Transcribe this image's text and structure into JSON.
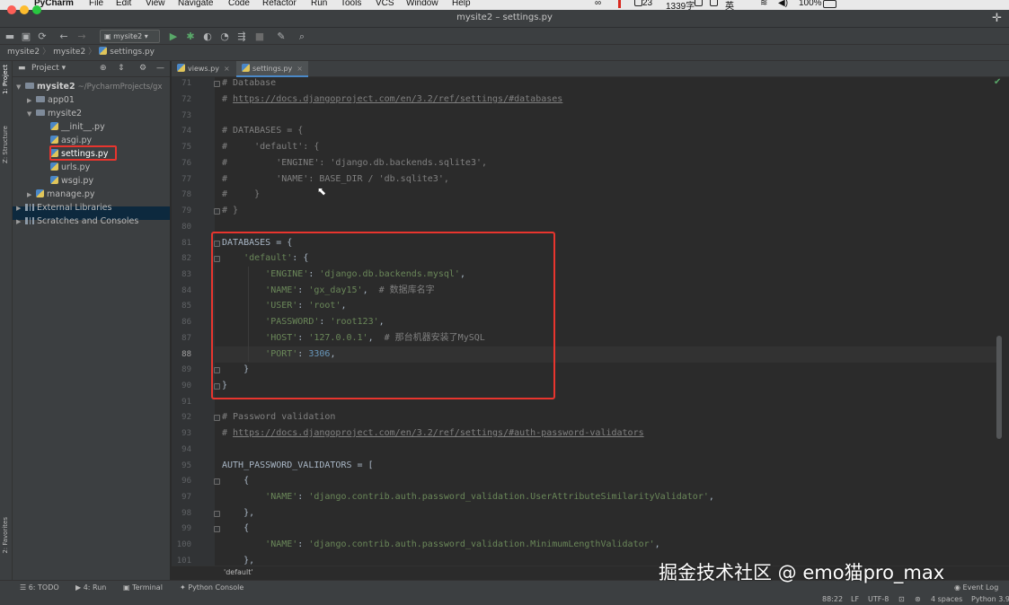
{
  "menubar": {
    "app_name": "PyCharm",
    "items": [
      "File",
      "Edit",
      "View",
      "Navigate",
      "Code",
      "Refactor",
      "Run",
      "Tools",
      "VCS",
      "Window",
      "Help"
    ],
    "status": {
      "badge": "23",
      "counter": "1339字",
      "battery": "100%",
      "lang": "英"
    }
  },
  "window": {
    "title": "mysite2 – settings.py"
  },
  "toolbar": {
    "run_config": "mysite2"
  },
  "breadcrumb": {
    "project": "mysite2",
    "folder": "mysite2",
    "file": "settings.py"
  },
  "left_stripe": {
    "project_tab": "1: Project",
    "structure_tab": "Z: Structure",
    "favorites_tab": "2: Favorites"
  },
  "project_panel": {
    "title": "Project",
    "tree": [
      {
        "label": "mysite2",
        "suffix": "~/PycharmProjects/gx",
        "type": "root-folder"
      },
      {
        "label": "app01",
        "type": "folder"
      },
      {
        "label": "mysite2",
        "type": "folder"
      },
      {
        "label": "__init__.py",
        "type": "py"
      },
      {
        "label": "asgi.py",
        "type": "py"
      },
      {
        "label": "settings.py",
        "type": "py",
        "selected": true
      },
      {
        "label": "urls.py",
        "type": "py"
      },
      {
        "label": "wsgi.py",
        "type": "py"
      },
      {
        "label": "manage.py",
        "type": "py"
      },
      {
        "label": "External Libraries",
        "type": "lib"
      },
      {
        "label": "Scratches and Consoles",
        "type": "scratch"
      }
    ]
  },
  "editor": {
    "tabs": [
      "views.py",
      "settings.py"
    ],
    "active_tab": "settings.py",
    "line_numbers": [
      "71",
      "72",
      "73",
      "74",
      "75",
      "76",
      "77",
      "78",
      "79",
      "80",
      "81",
      "82",
      "83",
      "84",
      "85",
      "86",
      "87",
      "88",
      "89",
      "90",
      "91",
      "92",
      "93",
      "94",
      "95",
      "96",
      "97",
      "98",
      "99",
      "100",
      "101"
    ],
    "current_line": "88",
    "footer_breadcrumb": "'default'"
  },
  "bottom_bar": {
    "todo": "6: TODO",
    "run": "4: Run",
    "terminal": "Terminal",
    "python_console": "Python Console",
    "event_log": "Event Log"
  },
  "status_bar": {
    "position": "88:22",
    "line_sep": "LF",
    "encoding": "UTF-8",
    "indent": "4 spaces",
    "interpreter": "Python 3.9"
  },
  "watermark": "掘金技术社区 @ emo猫pro_max",
  "colors": {
    "highlight_box": "#e8352e",
    "selection": "#0d293e",
    "accent_blue": "#4a88c7"
  }
}
